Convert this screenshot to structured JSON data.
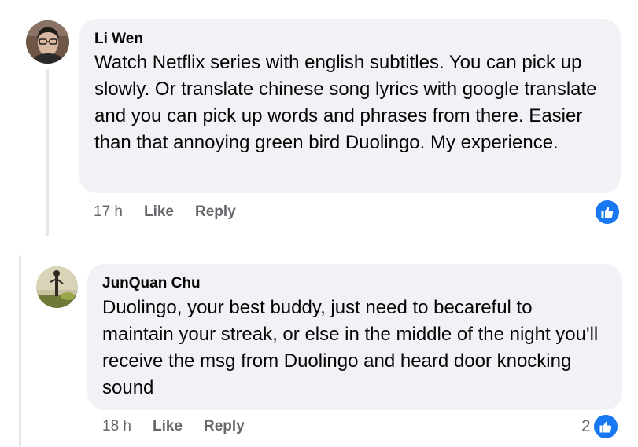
{
  "comments": [
    {
      "author": "Li Wen",
      "text": "Watch Netflix series with english subtitles. You can pick up slowly. Or translate chinese song lyrics with google translate and you can pick up words and phrases from there. Easier than that annoying green bird Duolingo. My experience.",
      "time": "17 h",
      "like_label": "Like",
      "reply_label": "Reply",
      "reaction_icon": "like-icon",
      "reaction_count": ""
    },
    {
      "author": "JunQuan Chu",
      "text": "Duolingo, your best buddy, just need to becareful to maintain your streak, or else in the middle of the night you'll receive the msg from Duolingo and heard door knocking sound",
      "time": "18 h",
      "like_label": "Like",
      "reply_label": "Reply",
      "reaction_icon": "like-icon",
      "reaction_count": "2"
    }
  ],
  "colors": {
    "bubble": "#f0f2f5",
    "meta_text": "#65676b",
    "like_blue": "#1877f2"
  }
}
